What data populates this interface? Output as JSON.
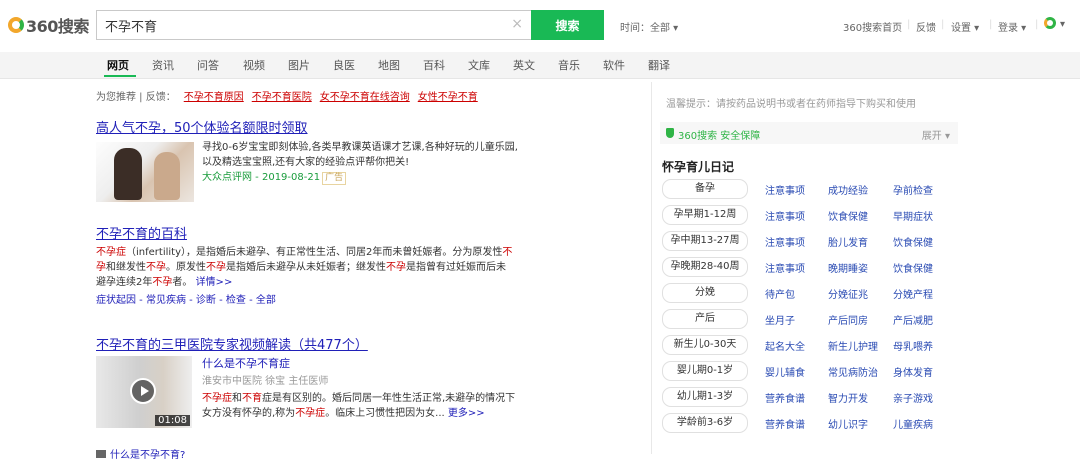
{
  "header": {
    "logo_text": "360搜索",
    "search_value": "不孕不育",
    "search_button": "搜索",
    "time_filter": "时间：全部 ▾",
    "home_link": "360搜索首页",
    "feedback": "反馈",
    "settings": "设置 ▾",
    "login": "登录 ▾"
  },
  "nav": {
    "tabs": [
      "网页",
      "资讯",
      "问答",
      "视频",
      "图片",
      "良医",
      "地图",
      "百科",
      "文库",
      "英文",
      "音乐",
      "软件",
      "翻译"
    ]
  },
  "recommend": {
    "prefix": "为您推荐 | 反馈：",
    "items": [
      "不孕不育原因",
      "不孕不育医院",
      "女不孕不育在线咨询",
      "女性不孕不育"
    ]
  },
  "results": [
    {
      "title": "高人气不孕，50个体验名额限时领取",
      "title_hl": "不孕",
      "snippet_line1": "寻找0-6岁宝宝即刻体验,各类早教课英语课才艺课,各种好玩的儿童乐园,",
      "snippet_line2": "以及精选宝宝照,还有大家的经验点评帮你把关!",
      "source": "大众点评网 - 2019-08-21",
      "ad_badge": "广告"
    },
    {
      "title": "不孕不育的百科",
      "line1_a": "不孕症",
      "line1_b": "（infertility），是指婚后未避孕、有正常性生活、同居2年而未曾妊娠者。分为原发性",
      "line1_c": "不",
      "line2_a": "孕",
      "line2_b": "和继发性",
      "line2_c": "不孕",
      "line2_d": "。原发性",
      "line2_e": "不孕",
      "line2_f": "是指婚后未避孕从未妊娠者；继发性",
      "line2_g": "不孕",
      "line2_h": "是指曾有过妊娠而后未",
      "line3_a": "避孕连续2年",
      "line3_b": "不孕",
      "line3_c": "者。",
      "more": "详情>>",
      "links": "症状起因 - 常见疾病 - 诊断 - 检查 - 全部"
    },
    {
      "title": "不孕不育的三甲医院专家视频解读（共477个）",
      "video_duration": "01:08",
      "q_title": "什么是不孕不育症",
      "q_source": "淮安市中医院  徐宝  主任医师",
      "q_line1_a": "不孕症",
      "q_line1_b": "和",
      "q_line1_c": "不育",
      "q_line1_d": "症是有区别的。婚后同居一年性生活正常,未避孕的情况下",
      "q_line2_a": "女方没有怀孕的,称为",
      "q_line2_b": "不孕症",
      "q_line2_c": "。临床上习惯性把因为女...",
      "q_more": "更多>>"
    }
  ],
  "next_title": "什么是不孕不育?",
  "right": {
    "tip": "温馨提示：请按药品说明书或者在药师指导下购买和使用",
    "safe": "360搜索  安全保障",
    "expand": "展开 ▾",
    "diary_title": "怀孕育儿日记",
    "rows": [
      {
        "stage": "备孕",
        "c1": "注意事项",
        "c2": "成功经验",
        "c3": "孕前检查"
      },
      {
        "stage": "孕早期1-12周",
        "c1": "注意事项",
        "c2": "饮食保健",
        "c3": "早期症状"
      },
      {
        "stage": "孕中期13-27周",
        "c1": "注意事项",
        "c2": "胎儿发育",
        "c3": "饮食保健"
      },
      {
        "stage": "孕晚期28-40周",
        "c1": "注意事项",
        "c2": "晚期睡姿",
        "c3": "饮食保健"
      },
      {
        "stage": "分娩",
        "c1": "待产包",
        "c2": "分娩征兆",
        "c3": "分娩产程"
      },
      {
        "stage": "产后",
        "c1": "坐月子",
        "c2": "产后同房",
        "c3": "产后减肥"
      },
      {
        "stage": "新生儿0-30天",
        "c1": "起名大全",
        "c2": "新生儿护理",
        "c3": "母乳喂养"
      },
      {
        "stage": "婴儿期0-1岁",
        "c1": "婴儿辅食",
        "c2": "常见病防治",
        "c3": "身体发育"
      },
      {
        "stage": "幼儿期1-3岁",
        "c1": "营养食谱",
        "c2": "智力开发",
        "c3": "亲子游戏"
      },
      {
        "stage": "学龄前3-6岁",
        "c1": "营养食谱",
        "c2": "幼儿识字",
        "c3": "儿童疾病"
      }
    ]
  }
}
